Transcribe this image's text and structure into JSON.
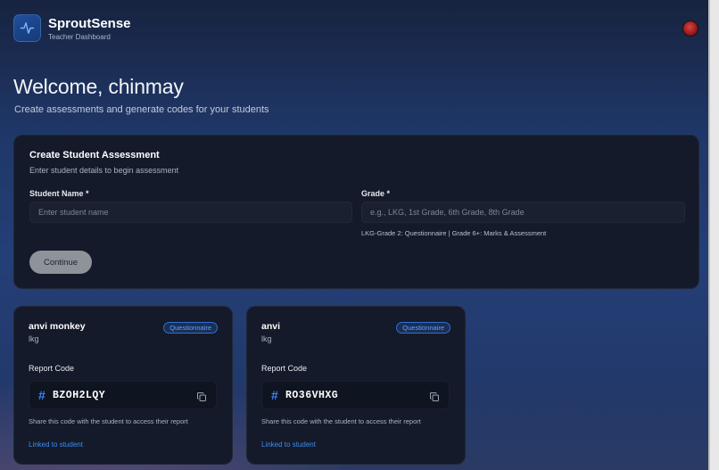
{
  "header": {
    "brand": "SproutSense",
    "subtitle": "Teacher Dashboard",
    "logo_icon": "pulse-icon",
    "avatar_icon": "user-avatar"
  },
  "welcome": {
    "title": "Welcome, chinmay",
    "subtitle": "Create assessments and generate codes for your students"
  },
  "form": {
    "title": "Create Student Assessment",
    "subtitle": "Enter student details to begin assessment",
    "name_label": "Student Name *",
    "name_placeholder": "Enter student name",
    "name_value": "",
    "grade_label": "Grade *",
    "grade_placeholder": "e.g., LKG, 1st Grade, 6th Grade, 8th Grade",
    "grade_value": "",
    "grade_hint": "LKG-Grade 2: Questionnaire | Grade 6+: Marks & Assessment",
    "continue_label": "Continue"
  },
  "cards": [
    {
      "name": "anvi monkey",
      "grade": "lkg",
      "badge": "Questionnaire",
      "code_label": "Report Code",
      "code": "BZOH2LQY",
      "share_text": "Share this code with the student to access their report",
      "linked_text": "Linked to student"
    },
    {
      "name": "anvi",
      "grade": "lkg",
      "badge": "Questionnaire",
      "code_label": "Report Code",
      "code": "RO36VHXG",
      "share_text": "Share this code with the student to access their report",
      "linked_text": "Linked to student"
    }
  ],
  "colors": {
    "accent": "#3b82f6",
    "panel_bg": "#141a29",
    "badge_border": "#2f6fd0"
  }
}
